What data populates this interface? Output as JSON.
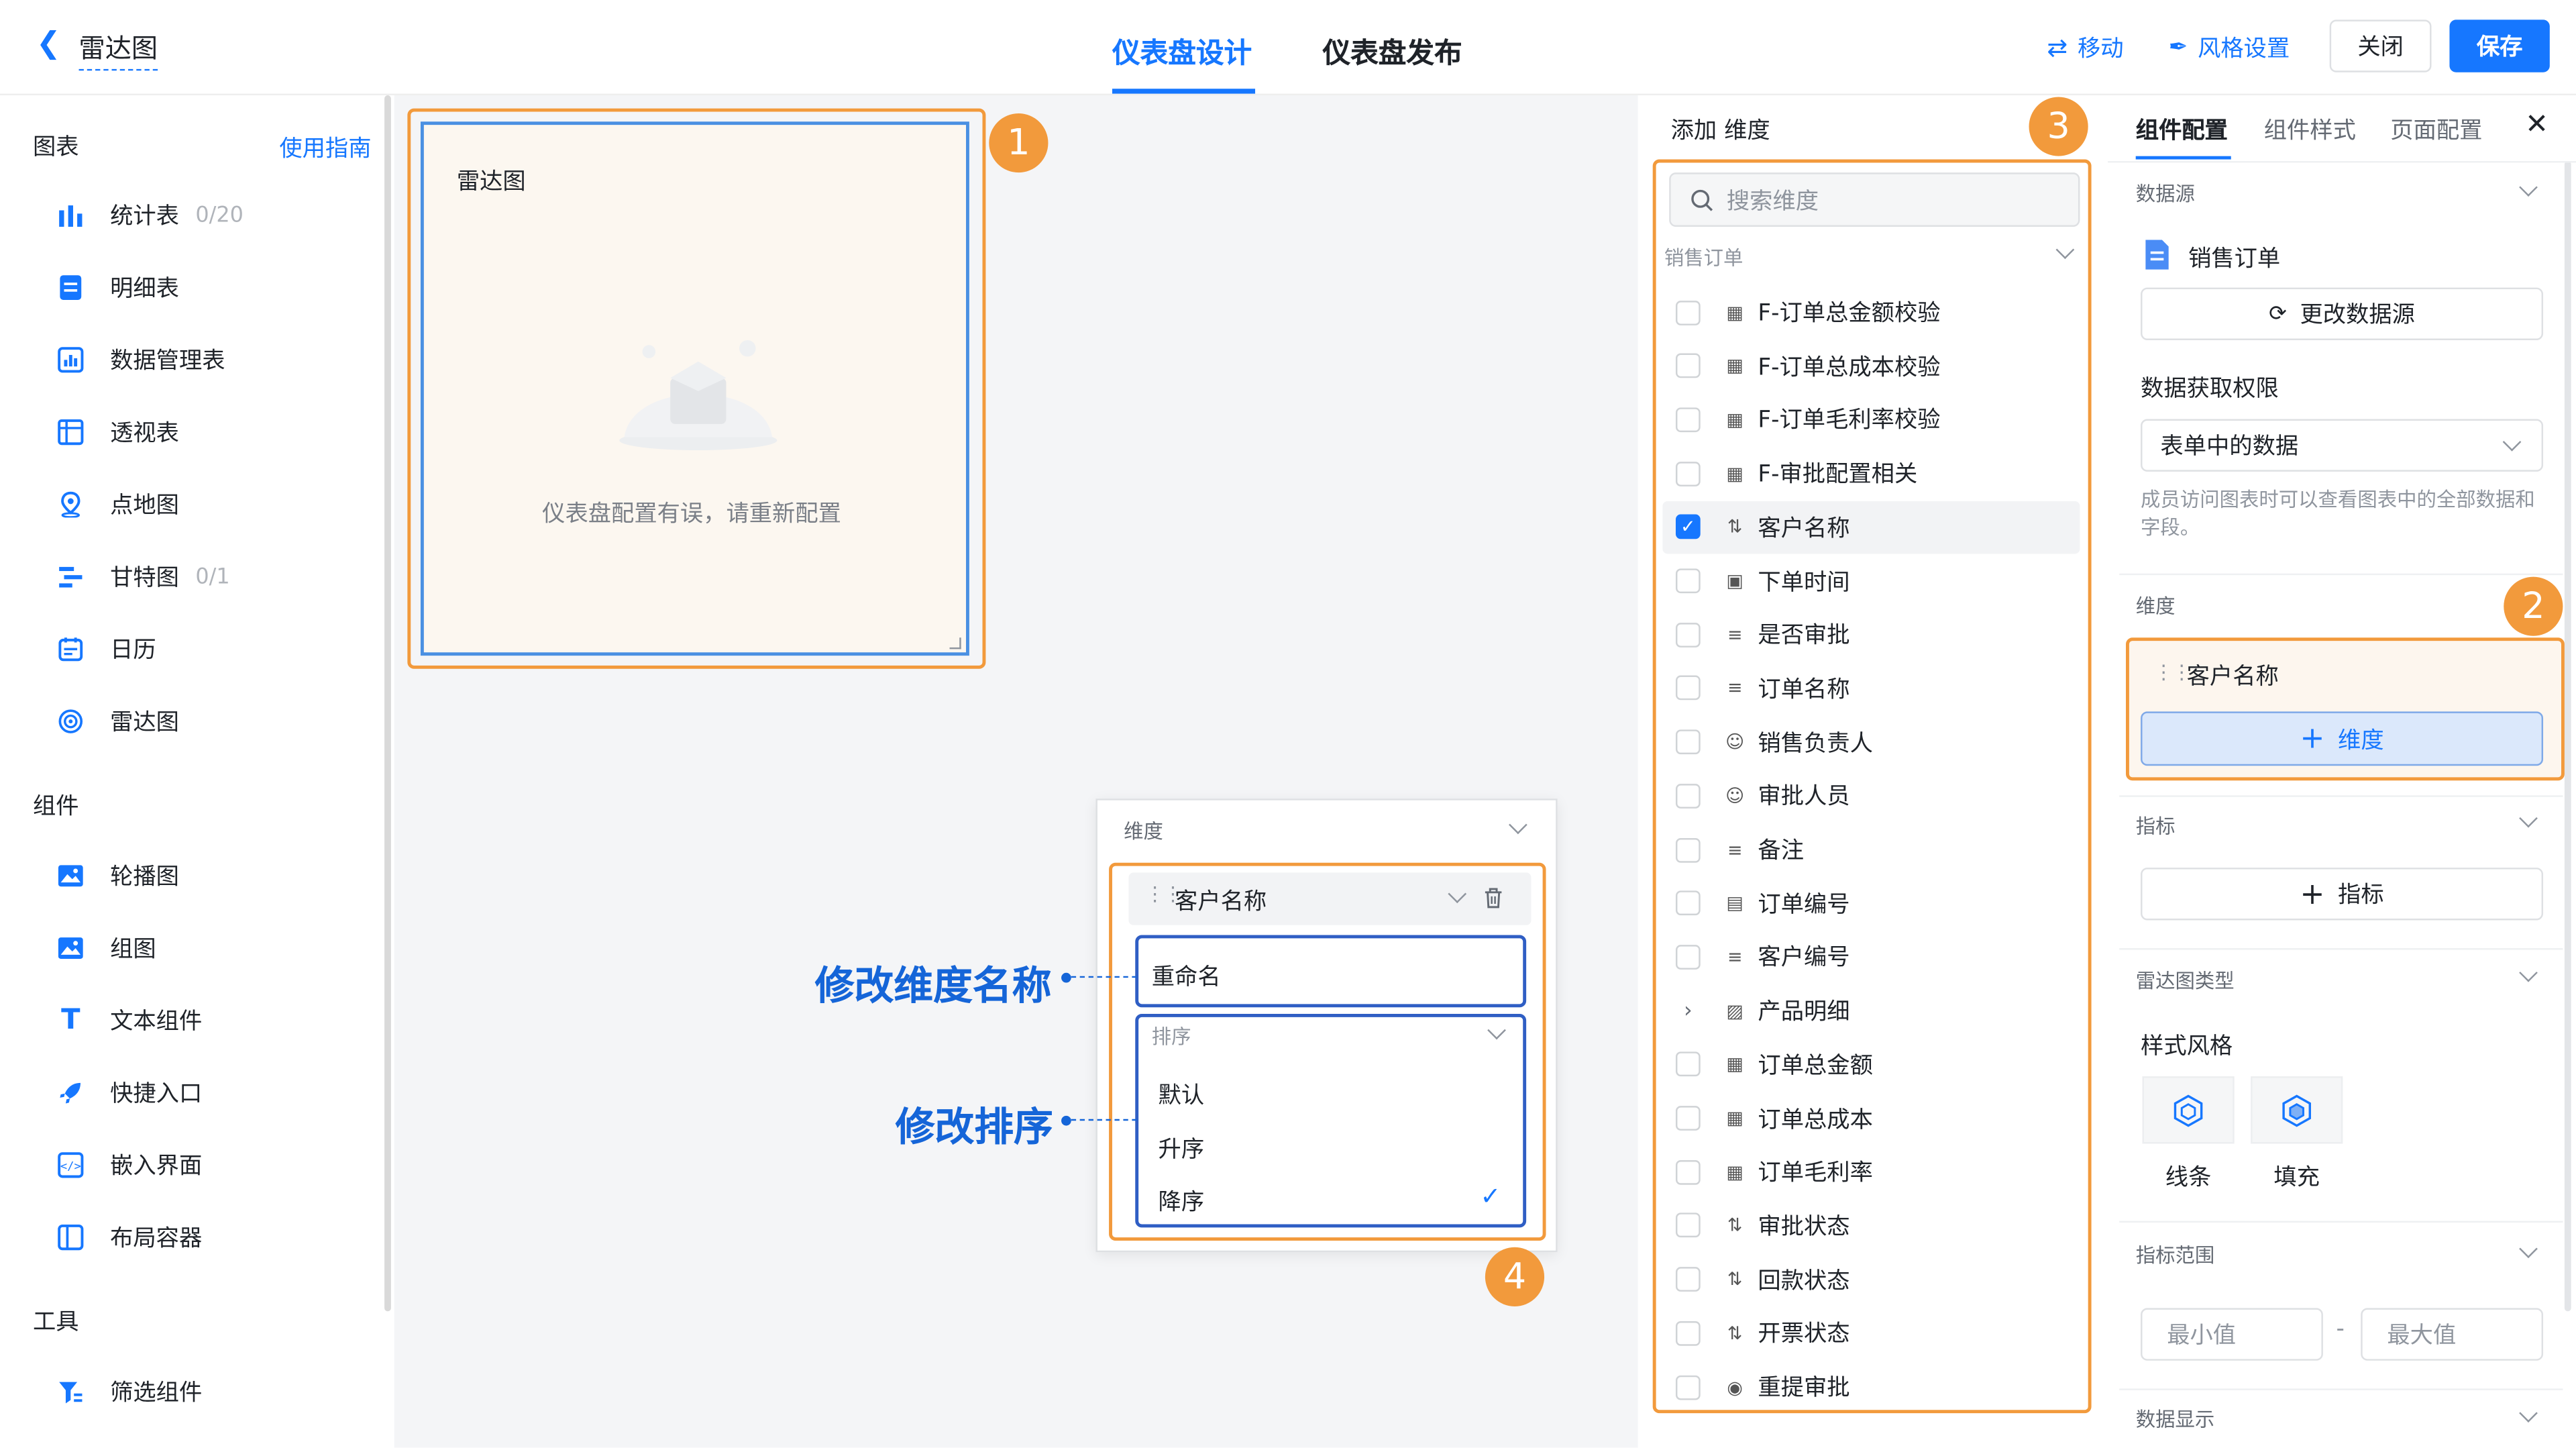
{
  "header": {
    "back_title": "雷达图",
    "tabs": [
      "仪表盘设计",
      "仪表盘发布"
    ],
    "move_label": "移动",
    "style_label": "风格设置",
    "close_label": "关闭",
    "save_label": "保存"
  },
  "sidebar": {
    "charts_title": "图表",
    "guide_link": "使用指南",
    "charts": [
      {
        "label": "统计表",
        "count": "0/20",
        "icon": "bar-chart-icon"
      },
      {
        "label": "明细表",
        "count": "",
        "icon": "detail-table-icon"
      },
      {
        "label": "数据管理表",
        "count": "",
        "icon": "data-table-icon"
      },
      {
        "label": "透视表",
        "count": "",
        "icon": "pivot-table-icon"
      },
      {
        "label": "点地图",
        "count": "",
        "icon": "map-pin-icon"
      },
      {
        "label": "甘特图",
        "count": "0/1",
        "icon": "gantt-icon"
      },
      {
        "label": "日历",
        "count": "",
        "icon": "calendar-icon"
      },
      {
        "label": "雷达图",
        "count": "",
        "icon": "radar-icon"
      }
    ],
    "components_title": "组件",
    "components": [
      {
        "label": "轮播图",
        "icon": "carousel-icon"
      },
      {
        "label": "组图",
        "icon": "image-group-icon"
      },
      {
        "label": "文本组件",
        "icon": "text-icon"
      },
      {
        "label": "快捷入口",
        "icon": "rocket-icon"
      },
      {
        "label": "嵌入界面",
        "icon": "embed-icon"
      },
      {
        "label": "布局容器",
        "icon": "layout-icon"
      }
    ],
    "tools_title": "工具",
    "tools": [
      {
        "label": "筛选组件",
        "icon": "filter-icon"
      }
    ]
  },
  "canvas": {
    "widget_title": "雷达图",
    "widget_error": "仪表盘配置有误，请重新配置",
    "badge1": "1",
    "badge4": "4",
    "annot_rename": "修改维度名称",
    "annot_sort": "修改排序"
  },
  "popup": {
    "section_title": "维度",
    "field_name": "客户名称",
    "rename_label": "重命名",
    "sort_label": "排序",
    "sort_options": [
      "默认",
      "升序",
      "降序"
    ],
    "sort_selected": "降序"
  },
  "dim_panel": {
    "title": "添加 维度",
    "badge3": "3",
    "search_placeholder": "搜索维度",
    "group": "销售订单",
    "items": [
      {
        "label": "F-订单总金额校验",
        "checked": false,
        "icon": "number-field-icon"
      },
      {
        "label": "F-订单总成本校验",
        "checked": false,
        "icon": "number-field-icon"
      },
      {
        "label": "F-订单毛利率校验",
        "checked": false,
        "icon": "number-field-icon"
      },
      {
        "label": "F-审批配置相关",
        "checked": false,
        "icon": "number-field-icon"
      },
      {
        "label": "客户名称",
        "checked": true,
        "icon": "sort-field-icon"
      },
      {
        "label": "下单时间",
        "checked": false,
        "icon": "date-field-icon"
      },
      {
        "label": "是否审批",
        "checked": false,
        "icon": "text-field-icon"
      },
      {
        "label": "订单名称",
        "checked": false,
        "icon": "text-field-icon"
      },
      {
        "label": "销售负责人",
        "checked": false,
        "icon": "person-field-icon"
      },
      {
        "label": "审批人员",
        "checked": false,
        "icon": "person-field-icon"
      },
      {
        "label": "备注",
        "checked": false,
        "icon": "text-field-icon"
      },
      {
        "label": "订单编号",
        "checked": false,
        "icon": "serial-field-icon"
      },
      {
        "label": "客户编号",
        "checked": false,
        "icon": "text-field-icon"
      },
      {
        "label": "产品明细",
        "checked": false,
        "icon": "subtable-field-icon",
        "expandable": true
      },
      {
        "label": "订单总金额",
        "checked": false,
        "icon": "number-field-icon"
      },
      {
        "label": "订单总成本",
        "checked": false,
        "icon": "number-field-icon"
      },
      {
        "label": "订单毛利率",
        "checked": false,
        "icon": "number-field-icon"
      },
      {
        "label": "审批状态",
        "checked": false,
        "icon": "sort-field-icon"
      },
      {
        "label": "回款状态",
        "checked": false,
        "icon": "sort-field-icon"
      },
      {
        "label": "开票状态",
        "checked": false,
        "icon": "sort-field-icon"
      },
      {
        "label": "重提审批",
        "checked": false,
        "icon": "radio-field-icon"
      }
    ]
  },
  "config": {
    "tabs": [
      "组件配置",
      "组件样式",
      "页面配置"
    ],
    "datasource_title": "数据源",
    "datasource_name": "销售订单",
    "change_source": "更改数据源",
    "permission_title": "数据获取权限",
    "permission_value": "表单中的数据",
    "permission_hint": "成员访问图表时可以查看图表中的全部数据和字段。",
    "dimension_title": "维度",
    "badge2": "2",
    "dimension_field": "客户名称",
    "add_dimension": "维度",
    "metric_title": "指标",
    "add_metric": "指标",
    "radar_type_title": "雷达图类型",
    "style_title": "样式风格",
    "style_options": [
      "线条",
      "填充"
    ],
    "range_title": "指标范围",
    "min_placeholder": "最小值",
    "max_placeholder": "最大值",
    "range_sep": "-",
    "display_title": "数据显示"
  }
}
